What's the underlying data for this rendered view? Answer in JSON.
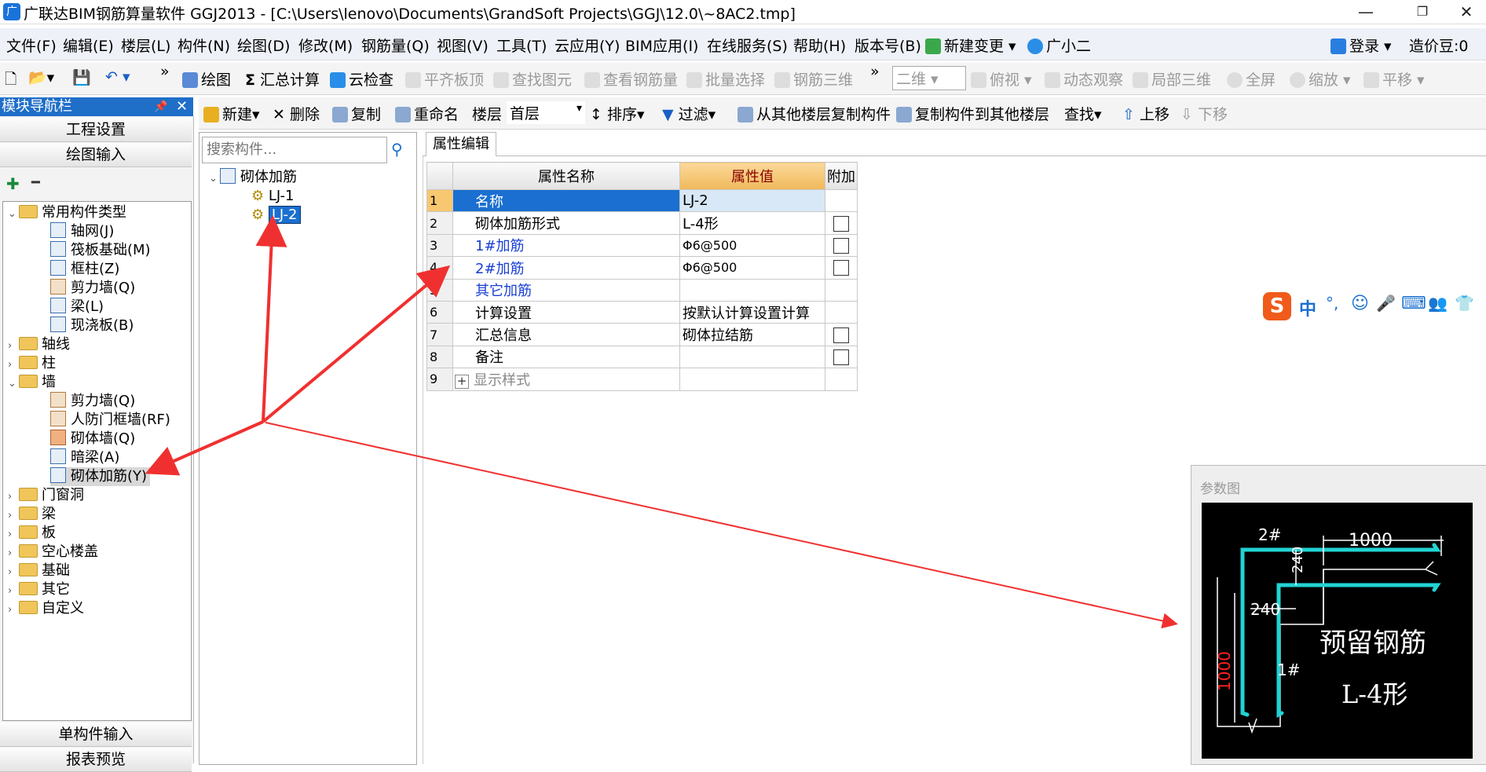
{
  "window": {
    "title": "广联达BIM钢筋算量软件 GGJ2013 - [C:\\Users\\lenovo\\Documents\\GrandSoft Projects\\GGJ\\12.0\\~8AC2.tmp]",
    "app_icon": "广",
    "minimize": "—",
    "restore": "❐",
    "close": "✕"
  },
  "menubar": {
    "items": [
      "文件(F)",
      "编辑(E)",
      "楼层(L)",
      "构件(N)",
      "绘图(D)",
      "修改(M)",
      "钢筋量(Q)",
      "视图(V)",
      "工具(T)",
      "云应用(Y)",
      "BIM应用(I)",
      "在线服务(S)",
      "帮助(H)",
      "版本号(B)",
      "新建变更",
      "广小二"
    ],
    "login": "登录",
    "coin": "造价豆:0"
  },
  "toolbar1": {
    "items": [
      "绘图",
      "汇总计算",
      "云检查",
      "平齐板顶",
      "查找图元",
      "查看钢筋量",
      "批量选择",
      "钢筋三维",
      "二维",
      "俯视",
      "动态观察",
      "局部三维",
      "全屏",
      "缩放",
      "平移"
    ],
    "sigma": "Σ",
    "more": "»"
  },
  "nav": {
    "title": "模块导航栏",
    "pin": "📌",
    "close": "✕",
    "project_settings": "工程设置",
    "drawing_input": "绘图输入",
    "single_input": "单构件输入",
    "report_preview": "报表预览",
    "expand_all": "✚",
    "collapse_all": "━",
    "tree": [
      {
        "label": "常用构件类型",
        "type": "folder",
        "expanded": true
      },
      {
        "label": "轴网(J)",
        "type": "item"
      },
      {
        "label": "筏板基础(M)",
        "type": "item"
      },
      {
        "label": "框柱(Z)",
        "type": "item"
      },
      {
        "label": "剪力墙(Q)",
        "type": "item"
      },
      {
        "label": "梁(L)",
        "type": "item"
      },
      {
        "label": "现浇板(B)",
        "type": "item"
      },
      {
        "label": "轴线",
        "type": "folder"
      },
      {
        "label": "柱",
        "type": "folder"
      },
      {
        "label": "墙",
        "type": "folder",
        "expanded": true
      },
      {
        "label": "剪力墙(Q)",
        "type": "item"
      },
      {
        "label": "人防门框墙(RF)",
        "type": "item"
      },
      {
        "label": "砌体墙(Q)",
        "type": "item"
      },
      {
        "label": "暗梁(A)",
        "type": "item"
      },
      {
        "label": "砌体加筋(Y)",
        "type": "item",
        "selected": true
      },
      {
        "label": "门窗洞",
        "type": "folder"
      },
      {
        "label": "梁",
        "type": "folder"
      },
      {
        "label": "板",
        "type": "folder"
      },
      {
        "label": "空心楼盖",
        "type": "folder"
      },
      {
        "label": "基础",
        "type": "folder"
      },
      {
        "label": "其它",
        "type": "folder"
      },
      {
        "label": "自定义",
        "type": "folder"
      }
    ]
  },
  "toolbar2": {
    "new": "新建",
    "delete": "删除",
    "copy": "复制",
    "rename": "重命名",
    "floor_label": "楼层",
    "floor_value": "首层",
    "sort": "排序",
    "filter": "过滤",
    "copy_from": "从其他楼层复制构件",
    "copy_to": "复制构件到其他楼层",
    "find": "查找",
    "up": "上移",
    "down": "下移"
  },
  "component_tree": {
    "search_placeholder": "搜索构件...",
    "root": "砌体加筋",
    "children": [
      "LJ-1",
      "LJ-2"
    ],
    "selected": "LJ-2"
  },
  "property_editor": {
    "tab": "属性编辑",
    "headers": [
      "属性名称",
      "属性值",
      "附加"
    ],
    "rows": [
      {
        "n": "1",
        "name": "名称",
        "value": "LJ-2",
        "check": false,
        "style": "sel"
      },
      {
        "n": "2",
        "name": "砌体加筋形式",
        "value": "L-4形",
        "check": true,
        "style": ""
      },
      {
        "n": "3",
        "name": "1#加筋",
        "value": "Φ6@500",
        "check": true,
        "style": "blue"
      },
      {
        "n": "4",
        "name": "2#加筋",
        "value": "Φ6@500",
        "check": true,
        "style": "blue"
      },
      {
        "n": "5",
        "name": "其它加筋",
        "value": "",
        "check": false,
        "style": "blue"
      },
      {
        "n": "6",
        "name": "计算设置",
        "value": "按默认计算设置计算",
        "check": false,
        "style": ""
      },
      {
        "n": "7",
        "name": "汇总信息",
        "value": "砌体拉结筋",
        "check": true,
        "style": ""
      },
      {
        "n": "8",
        "name": "备注",
        "value": "",
        "check": true,
        "style": ""
      },
      {
        "n": "9",
        "name": "显示样式",
        "value": "",
        "check": false,
        "style": "grey",
        "expander": "+"
      }
    ]
  },
  "ime": {
    "items": [
      "S",
      "中",
      "°,",
      "☺",
      "🎤",
      "⌨",
      "👥",
      "👕"
    ]
  },
  "param_figure": {
    "label": "参数图",
    "caption1": "预留钢筋",
    "caption2": "L-4形",
    "dim_top": "1000",
    "dim_240a": "240",
    "dim_240b": "240",
    "dim_left": "1000",
    "bar1": "1#",
    "bar2": "2#",
    "colors": {
      "bar": "#22d3d3",
      "dim": "#ffffff",
      "red": "#ff2020"
    }
  },
  "annotation_color": "#f03030"
}
